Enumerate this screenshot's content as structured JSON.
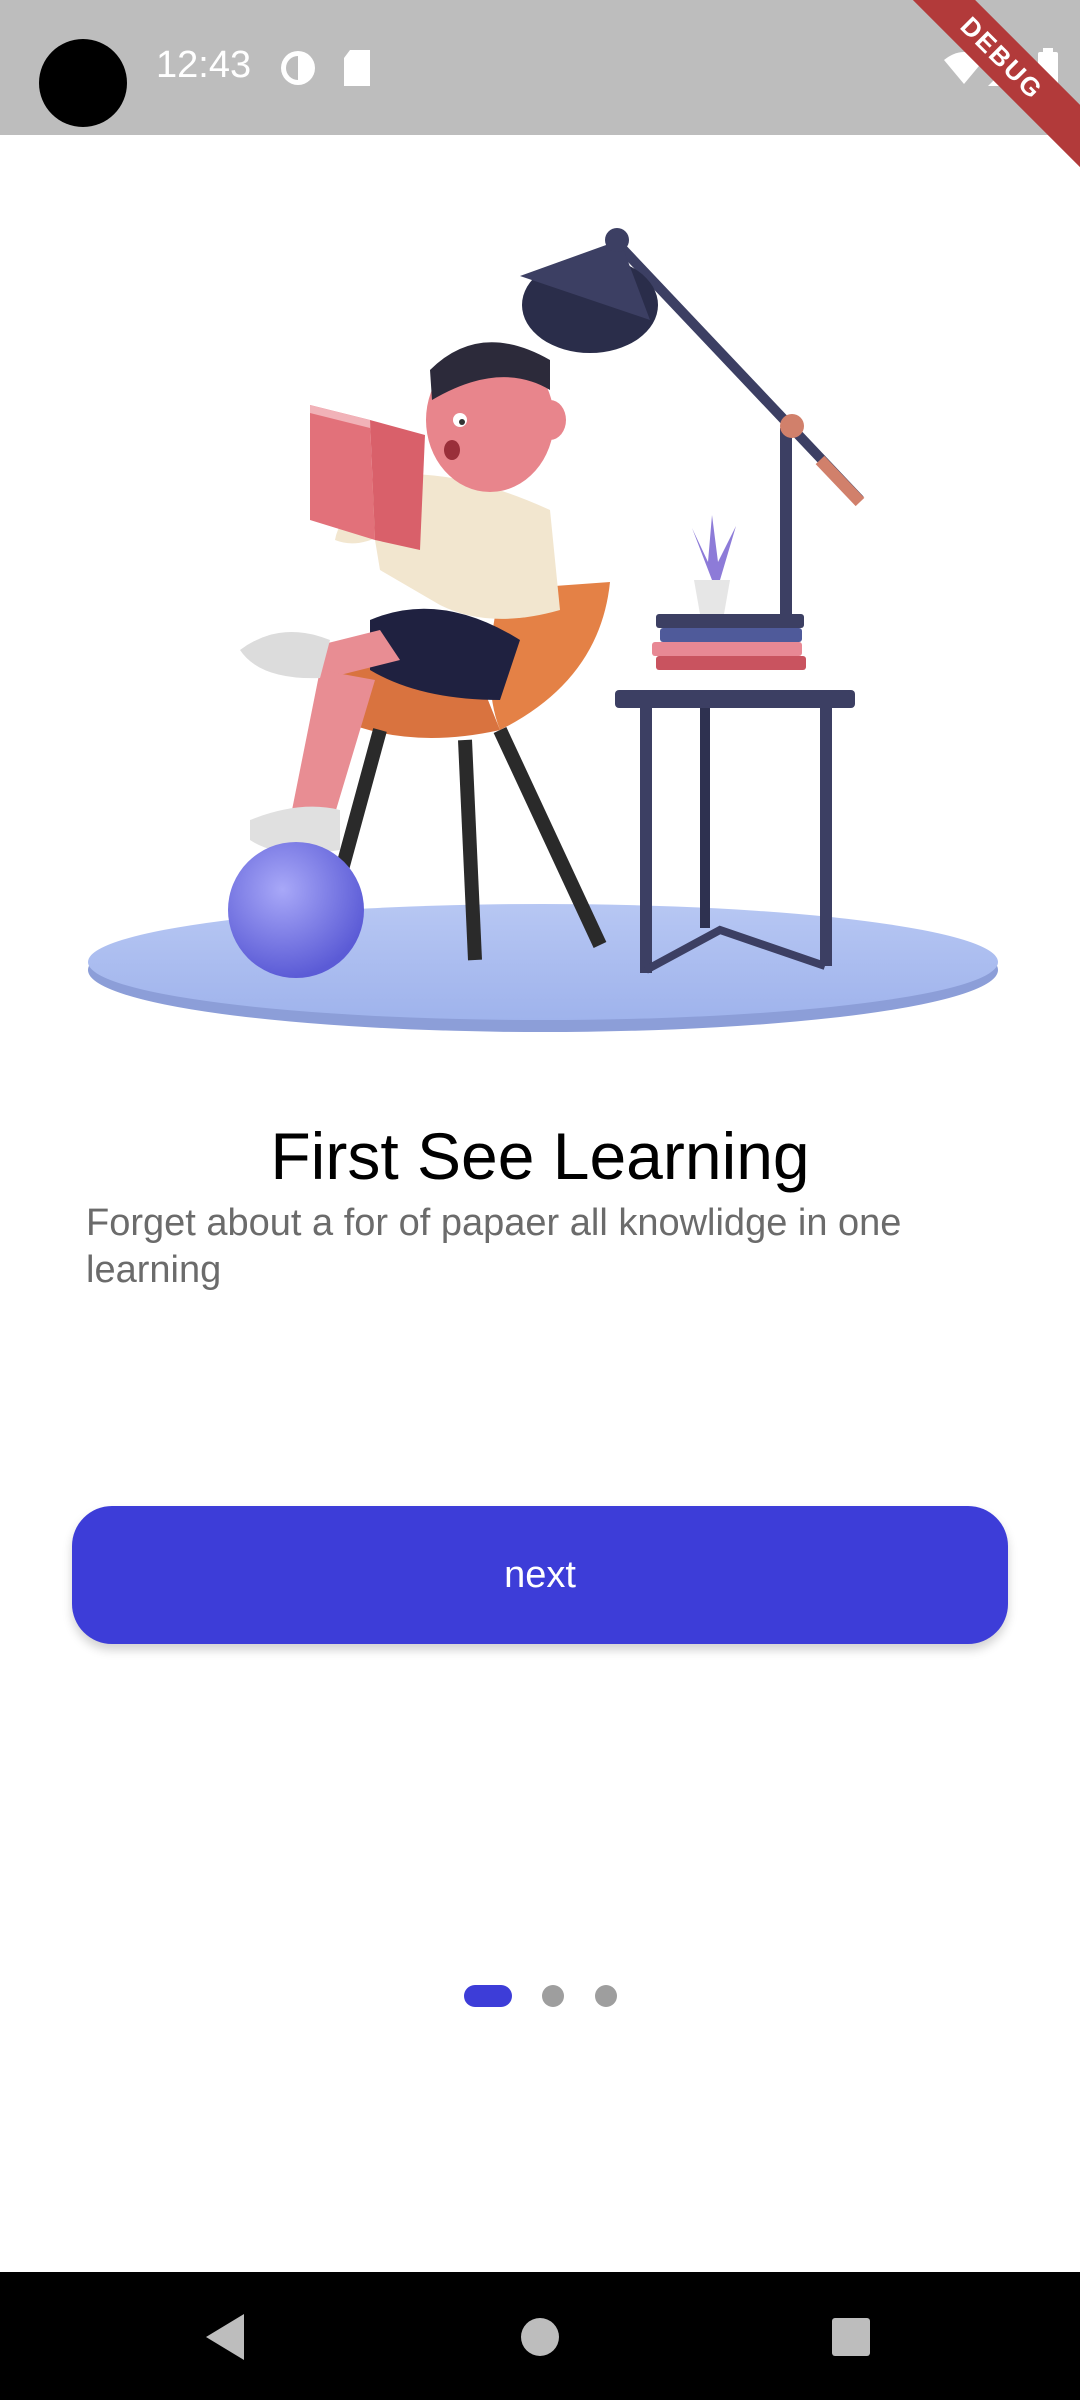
{
  "status_bar": {
    "time": "12:43",
    "debug_banner": "DEBUG",
    "icons": [
      "camera-cutout",
      "data-saver-icon",
      "sd-card-icon",
      "wifi-icon",
      "cell-signal-icon",
      "battery-icon"
    ]
  },
  "onboarding": {
    "title": "First See Learning",
    "description": "Forget about a for of papaer all knowlidge in one learning",
    "next_label": "next",
    "page_indicator": {
      "total": 3,
      "current": 1
    }
  },
  "nav_bar": {
    "icons": [
      "back-icon",
      "home-icon",
      "recents-icon"
    ]
  },
  "colors": {
    "accent": "#3d3dd8",
    "inactive_dot": "#9e9e9e",
    "status_bar": "#bdbdbd",
    "description_text": "#6b6b6b",
    "debug_ribbon": "#b23a3a"
  }
}
